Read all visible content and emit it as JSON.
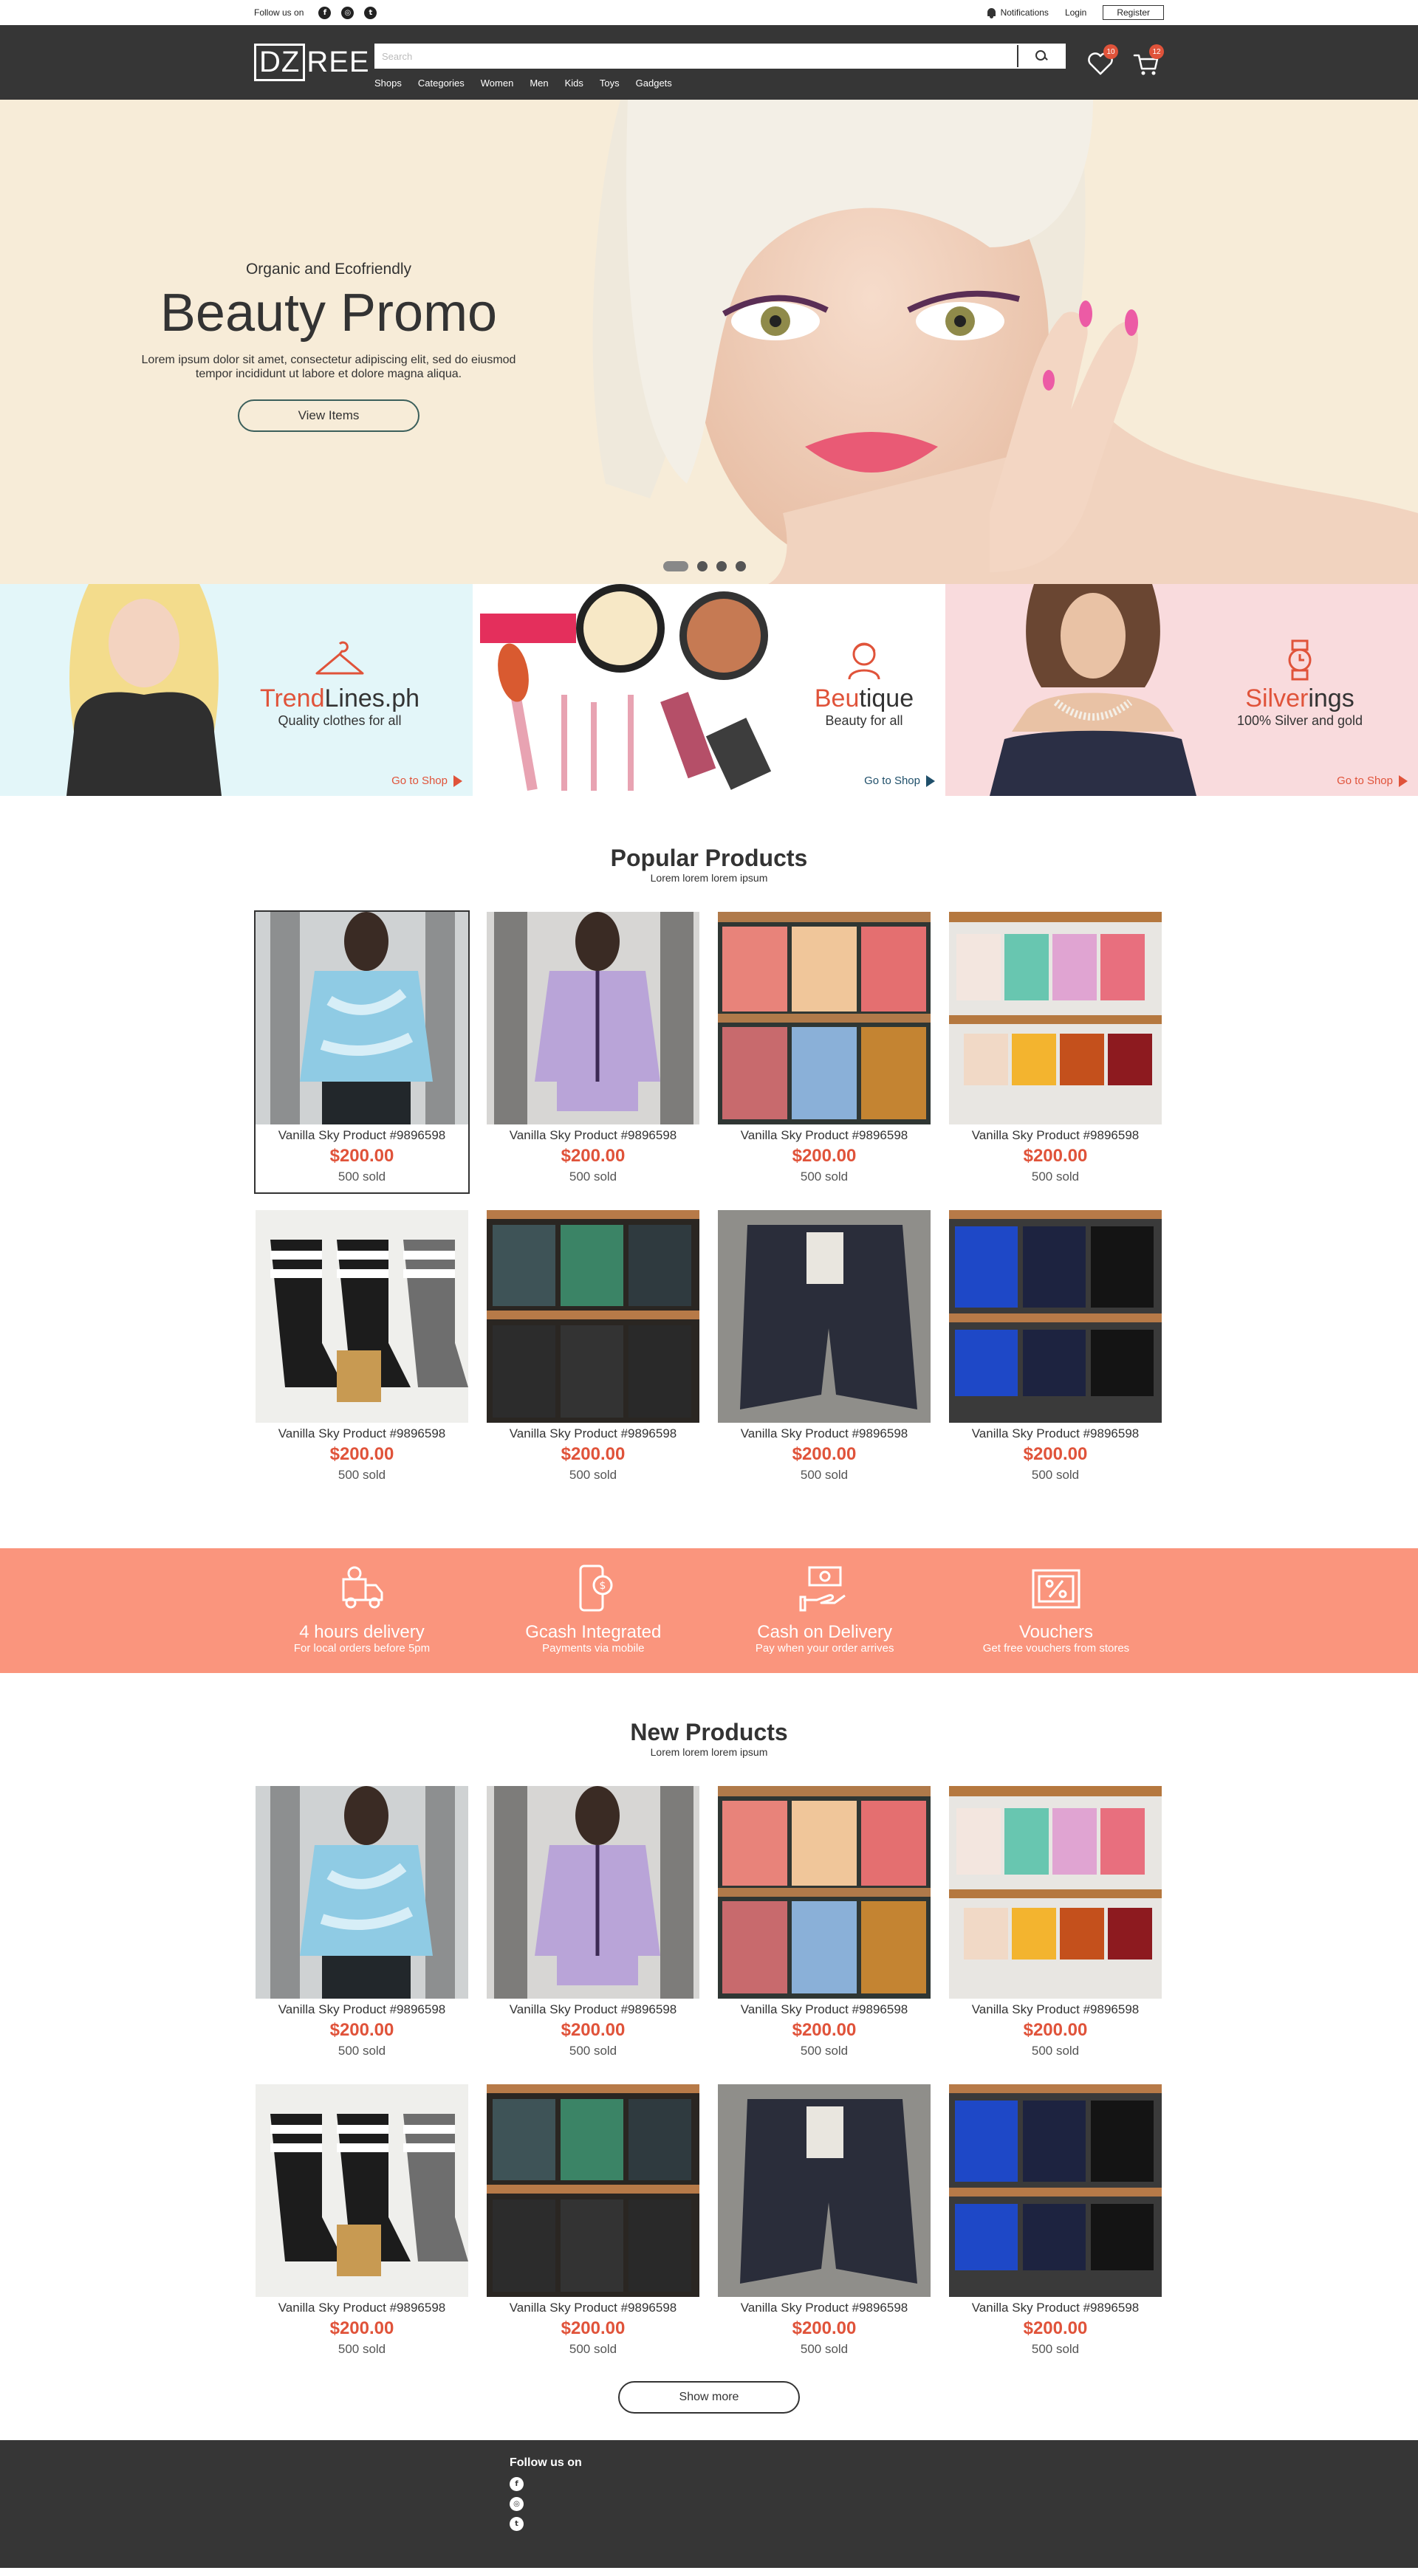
{
  "topbar": {
    "follow_label": "Follow us on",
    "social_icons": [
      "facebook-icon",
      "instagram-icon",
      "twitter-icon"
    ],
    "notifications_label": "Notifications",
    "login_label": "Login",
    "register_label": "Register"
  },
  "header": {
    "logo_box": "DZ",
    "logo_rest": "REE",
    "search_placeholder": "Search",
    "nav": [
      "Shops",
      "Categories",
      "Women",
      "Men",
      "Kids",
      "Toys",
      "Gadgets"
    ],
    "wishlist_count": "10",
    "cart_count": "12"
  },
  "hero": {
    "eyebrow": "Organic and Ecofriendly",
    "title": "Beauty Promo",
    "description": "Lorem ipsum dolor sit amet, consectetur adipiscing elit, sed do eiusmod tempor incididunt ut labore et dolore magna aliqua.",
    "button_label": "View Items",
    "slide_count": 4,
    "active_slide": 1
  },
  "shops": [
    {
      "accent": "Trend",
      "rest": "Lines.ph",
      "subtitle": "Quality clothes for all",
      "cta": "Go to Shop",
      "cta_color": "#e0533a",
      "icon": "hanger-icon"
    },
    {
      "accent": "Beu",
      "rest": "tique",
      "subtitle": "Beauty for all",
      "cta": "Go to Shop",
      "cta_color": "#1f4f6a",
      "icon": "stylist-icon"
    },
    {
      "accent": "Silver",
      "rest": "ings",
      "subtitle": "100% Silver and gold",
      "cta": "Go to Shop",
      "cta_color": "#e0533a",
      "icon": "watch-icon"
    }
  ],
  "popular": {
    "title": "Popular Products",
    "subtitle": "Lorem lorem lorem ipsum",
    "products": [
      {
        "name": "Vanilla Sky Product #9896598",
        "price": "$200.00",
        "sold": "500 sold"
      },
      {
        "name": "Vanilla Sky Product #9896598",
        "price": "$200.00",
        "sold": "500 sold"
      },
      {
        "name": "Vanilla Sky Product #9896598",
        "price": "$200.00",
        "sold": "500 sold"
      },
      {
        "name": "Vanilla Sky Product #9896598",
        "price": "$200.00",
        "sold": "500 sold"
      },
      {
        "name": "Vanilla Sky Product #9896598",
        "price": "$200.00",
        "sold": "500 sold"
      },
      {
        "name": "Vanilla Sky Product #9896598",
        "price": "$200.00",
        "sold": "500 sold"
      },
      {
        "name": "Vanilla Sky Product #9896598",
        "price": "$200.00",
        "sold": "500 sold"
      },
      {
        "name": "Vanilla Sky Product #9896598",
        "price": "$200.00",
        "sold": "500 sold"
      }
    ]
  },
  "features": [
    {
      "title": "4 hours delivery",
      "subtitle": "For local orders before 5pm",
      "icon": "delivery-truck-icon"
    },
    {
      "title": "Gcash Integrated",
      "subtitle": "Payments via mobile",
      "icon": "mobile-payment-icon"
    },
    {
      "title": "Cash on Delivery",
      "subtitle": "Pay when your order arrives",
      "icon": "cash-hand-icon"
    },
    {
      "title": "Vouchers",
      "subtitle": "Get free vouchers from stores",
      "icon": "voucher-icon"
    }
  ],
  "new_products": {
    "title": "New Products",
    "subtitle": "Lorem lorem lorem ipsum",
    "products": [
      {
        "name": "Vanilla Sky Product #9896598",
        "price": "$200.00",
        "sold": "500 sold"
      },
      {
        "name": "Vanilla Sky Product #9896598",
        "price": "$200.00",
        "sold": "500 sold"
      },
      {
        "name": "Vanilla Sky Product #9896598",
        "price": "$200.00",
        "sold": "500 sold"
      },
      {
        "name": "Vanilla Sky Product #9896598",
        "price": "$200.00",
        "sold": "500 sold"
      },
      {
        "name": "Vanilla Sky Product #9896598",
        "price": "$200.00",
        "sold": "500 sold"
      },
      {
        "name": "Vanilla Sky Product #9896598",
        "price": "$200.00",
        "sold": "500 sold"
      },
      {
        "name": "Vanilla Sky Product #9896598",
        "price": "$200.00",
        "sold": "500 sold"
      },
      {
        "name": "Vanilla Sky Product #9896598",
        "price": "$200.00",
        "sold": "500 sold"
      }
    ],
    "show_more_label": "Show more"
  },
  "footer": {
    "follow_label": "Follow us on",
    "social_icons": [
      "facebook-icon",
      "instagram-icon",
      "twitter-icon"
    ]
  },
  "colors": {
    "accent": "#e0533a",
    "header_bg": "#363636",
    "hero_bg": "#f7ecd8",
    "features_bg": "#fa957d"
  }
}
